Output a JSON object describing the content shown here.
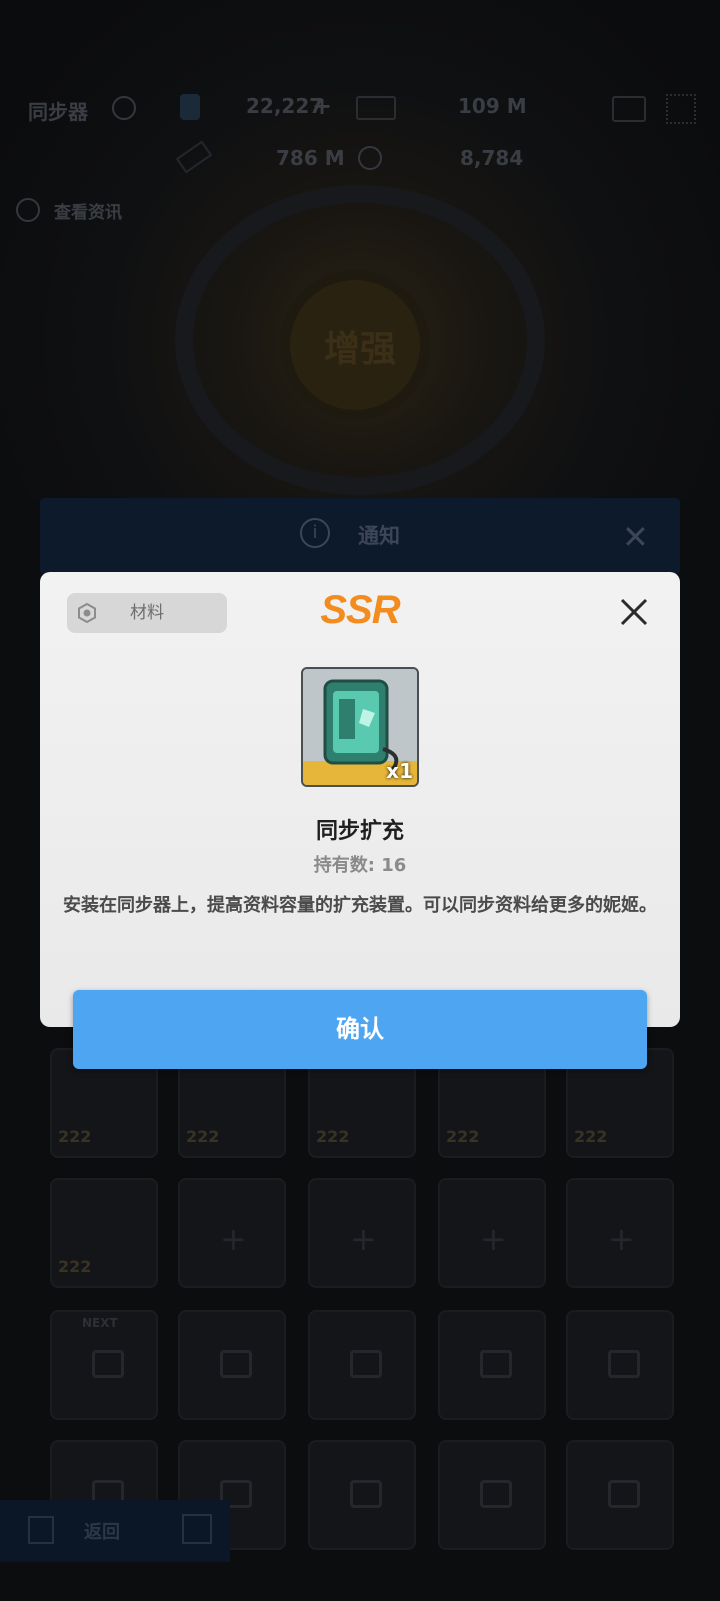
{
  "background": {
    "resource_label": "同步器",
    "gem_count": "22,227",
    "credits": "109 M",
    "core_dust": "786 M",
    "body_label": "8,784",
    "info_link": "查看资讯",
    "enhance_label": "增强",
    "slot_levels": [
      "222",
      "222",
      "222",
      "222",
      "222",
      "222"
    ],
    "next_label": "NEXT",
    "back_label": "返回"
  },
  "notice": {
    "title": "通知"
  },
  "modal": {
    "category": "材料",
    "rarity": "SSR",
    "quantity": "x1",
    "item_name": "同步扩充",
    "owned_label": "持有数:",
    "owned_count": "16",
    "description": "安装在同步器上，提高资料容量的扩充装置。可以同步资料给更多的妮姬。",
    "confirm_label": "确认"
  },
  "colors": {
    "accent": "#4ea6f2",
    "rarity": "#f28c1e"
  }
}
